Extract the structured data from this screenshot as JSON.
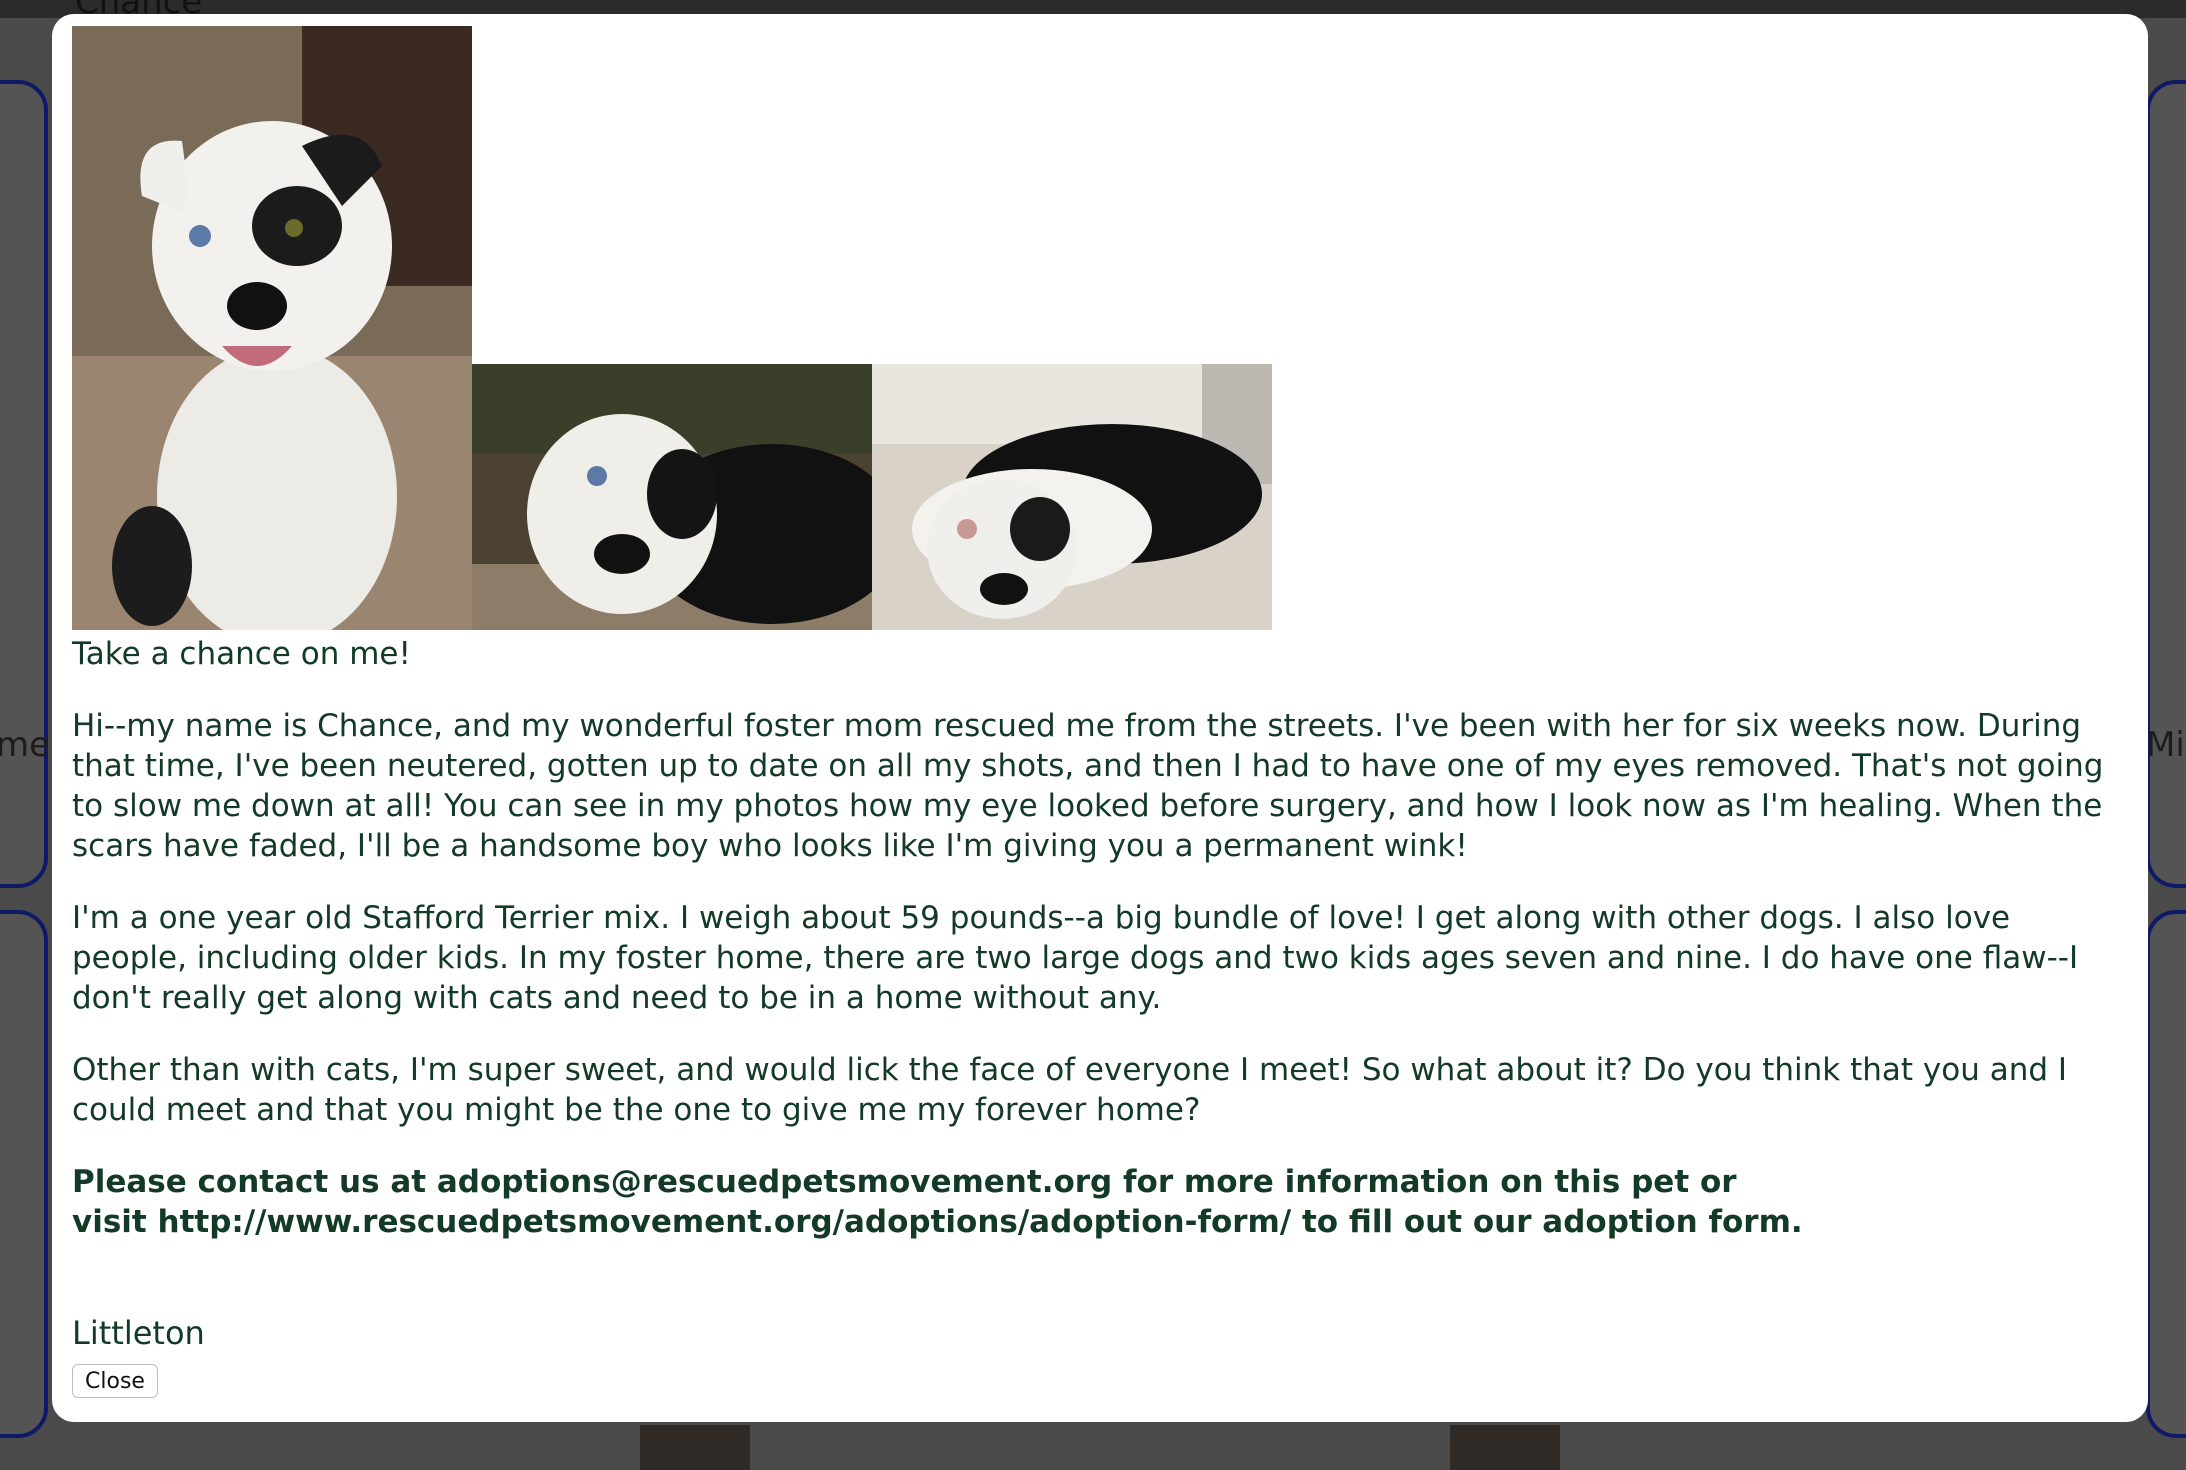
{
  "background": {
    "page_title": "Chance",
    "side_left_text": "meric",
    "side_right_text": "Mix"
  },
  "modal": {
    "photos": [
      {
        "alt": "Chance sitting, smiling",
        "icon": "dog-photo"
      },
      {
        "alt": "Chance lying, close-up face",
        "icon": "dog-photo"
      },
      {
        "alt": "Chance resting on tile floor",
        "icon": "dog-photo"
      }
    ],
    "tagline": "Take a chance on me!",
    "paragraphs": [
      "Hi--my name is Chance, and my wonderful foster mom rescued me from the streets. I've been with her for six weeks now. During that time, I've been neutered, gotten up to date on all my shots, and then I had to have one of my eyes removed. That's not going to slow me down at all! You can see in my photos how my eye looked before surgery, and how I look now as I'm healing. When the scars have faded, I'll be a handsome boy who looks like I'm giving you a permanent wink!",
      "I'm a one year old Stafford Terrier mix. I weigh about 59 pounds--a big bundle of love! I get along with other dogs. I also love people, including older kids. In my foster home, there are two large dogs and two kids ages seven and nine. I do have one flaw--I don't really get along with cats and need to be in a home without any.",
      "Other than with cats, I'm super sweet, and would lick the face of everyone I meet! So what about it? Do you think that you and I could meet and that you might be the one to give me my forever home?"
    ],
    "contact_line1": "Please contact us at adoptions@rescuedpetsmovement.org for more information on this pet or",
    "contact_line2": "visit http://www.rescuedpetsmovement.org/adoptions/adoption-form/ to fill out our adoption form.",
    "location": "Littleton",
    "close_label": "Close"
  },
  "colors": {
    "text": "#133a26",
    "overlay": "#4a4a4a",
    "card_border": "#0f1a66"
  }
}
